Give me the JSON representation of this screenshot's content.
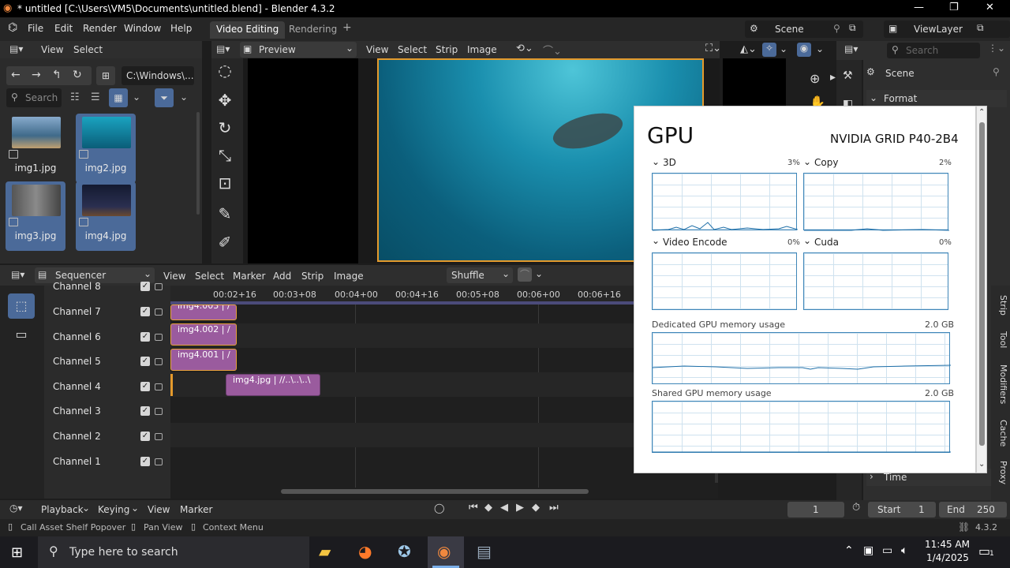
{
  "window": {
    "title": "* untitled [C:\\Users\\VM5\\Documents\\untitled.blend] - Blender 4.3.2"
  },
  "menu": {
    "items": [
      "File",
      "Edit",
      "Render",
      "Window",
      "Help"
    ]
  },
  "workspaces": {
    "tabs": [
      "Video Editing",
      "Rendering"
    ],
    "add": "+"
  },
  "scene": {
    "label": "Scene",
    "viewlayer": "ViewLayer"
  },
  "filebrowser": {
    "menu": [
      "View",
      "Select"
    ],
    "path": "C:\\Windows\\...",
    "search_placeholder": "Search",
    "files": [
      {
        "name": "img1.jpg",
        "selected": false,
        "color": "#6c8ba8"
      },
      {
        "name": "img2.jpg",
        "selected": true,
        "color": "#1e8fa8"
      },
      {
        "name": "img3.jpg",
        "selected": true,
        "color": "#6a6a6a"
      },
      {
        "name": "img4.jpg",
        "selected": true,
        "color": "#1d2238"
      }
    ]
  },
  "preview": {
    "mode": "Preview",
    "menu": [
      "View",
      "Select",
      "Strip",
      "Image"
    ]
  },
  "sequencer": {
    "editor": "Sequencer",
    "menu": [
      "View",
      "Select",
      "Marker",
      "Add",
      "Strip",
      "Image"
    ],
    "pivot": "Shuffle",
    "ticks": [
      "00:02+16",
      "00:03+08",
      "00:04+00",
      "00:04+16",
      "00:05+08",
      "00:06+00",
      "00:06+16"
    ],
    "channels": [
      "Channel 8",
      "Channel 7",
      "Channel 6",
      "Channel 5",
      "Channel 4",
      "Channel 3",
      "Channel 2",
      "Channel 1"
    ],
    "strips": [
      {
        "label": "img4.003 | /"
      },
      {
        "label": "img4.002 | /"
      },
      {
        "label": "img4.001 | /"
      },
      {
        "label": "img4.jpg | //..\\..\\..\\"
      }
    ]
  },
  "gpu": {
    "title": "GPU",
    "model": "NVIDIA GRID P40-2B4",
    "engines": [
      {
        "name": "3D",
        "value": "3%"
      },
      {
        "name": "Copy",
        "value": "2%"
      },
      {
        "name": "Video Encode",
        "value": "0%"
      },
      {
        "name": "Cuda",
        "value": "0%"
      }
    ],
    "dedicated": {
      "label": "Dedicated GPU memory usage",
      "value": "2.0 GB"
    },
    "shared": {
      "label": "Shared GPU memory usage",
      "value": "2.0 GB"
    }
  },
  "props": {
    "scene": "Scene",
    "section": "Format",
    "time": "Time",
    "search_placeholder": "Search"
  },
  "sidetabs": [
    "Strip",
    "Tool",
    "Modifiers",
    "Cache",
    "Proxy"
  ],
  "timeline": {
    "menu": [
      "Playback",
      "Keying",
      "View",
      "Marker"
    ],
    "frame": "1",
    "start_label": "Start",
    "start": "1",
    "end_label": "End",
    "end": "250"
  },
  "status": {
    "items": [
      "Call Asset Shelf Popover",
      "Pan View",
      "Context Menu"
    ],
    "version": "4.3.2"
  },
  "taskbar": {
    "search_placeholder": "Type here to search",
    "time": "11:45 AM",
    "date": "1/4/2025",
    "notif": "1"
  }
}
